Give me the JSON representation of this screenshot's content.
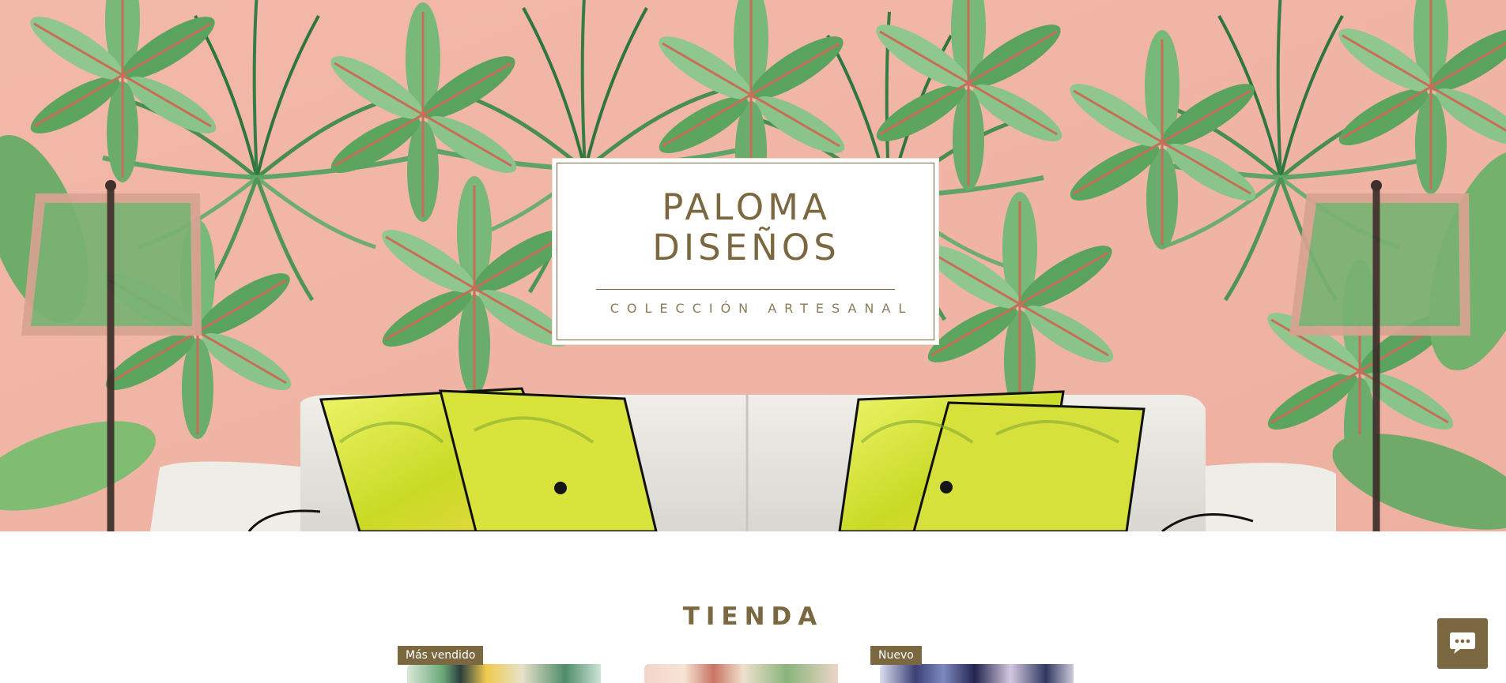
{
  "brand": {
    "title_line1": "PALOMA",
    "title_line2": "DISEÑOS",
    "subtitle": "COLECCIÓN ARTESANAL"
  },
  "hero": {
    "scene": "tropical-living-room"
  },
  "shop": {
    "title": "TIENDA",
    "products": [
      {
        "badge": "Más vendido"
      },
      {
        "badge": ""
      },
      {
        "badge": "Nuevo"
      }
    ]
  },
  "chat": {
    "icon": "chat-bubble-icon"
  },
  "colors": {
    "accent": "#7b6840",
    "background_pink": "#efb7a7",
    "palm_green": "#4d9a58",
    "cushion_yellow": "#d8df35",
    "white": "#ffffff"
  }
}
